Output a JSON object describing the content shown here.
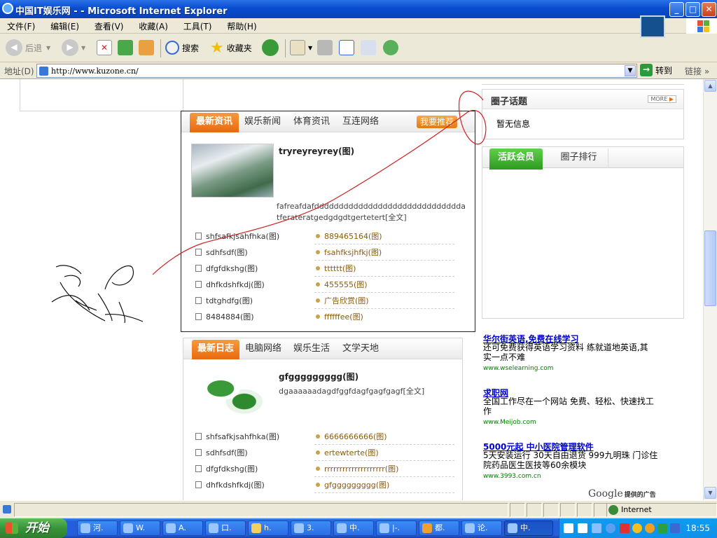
{
  "window": {
    "title": "中国IT娱乐网 - - Microsoft Internet Explorer",
    "min": "_",
    "max": "□",
    "close": "✕"
  },
  "menu": [
    "文件(F)",
    "编辑(E)",
    "查看(V)",
    "收藏(A)",
    "工具(T)",
    "帮助(H)"
  ],
  "toolbar": {
    "back": "后退",
    "search": "搜索",
    "favorites": "收藏夹"
  },
  "address": {
    "label": "地址(D)",
    "url": "http://www.kuzone.cn/",
    "go": "转到",
    "links": "链接"
  },
  "news": {
    "tabs": [
      "最新资讯",
      "娱乐新闻",
      "体育资讯",
      "互连网络"
    ],
    "recommend": "我要推荐",
    "headline": "tryreyreyrey(图)",
    "summary": "fafreafdafddddddddddddddddddddddddddddddatferateratgedgdgdtgertetert[全文]",
    "left": [
      "shfsafkjsahfhka(图)",
      "sdhfsdf(图)",
      "dfgfdkshg(图)",
      "dhfkdshfkdj(图)",
      "tdtghdfg(图)",
      "8484884(图)"
    ],
    "right": [
      "889465164(图)",
      "fsahfksjhfkj(图)",
      "tttttt(图)",
      "455555(图)",
      "广告欣赏(图)",
      "ffffffee(图)"
    ]
  },
  "blog": {
    "tabs": [
      "最新日志",
      "电脑网络",
      "娱乐生活",
      "文学天地"
    ],
    "headline": "gfggggggggg(图)",
    "summary": "dgaaaaaadagdfggfdagfgagfgagf[全文]",
    "left": [
      "shfsafkjsahfhka(图)",
      "sdhfsdf(图)",
      "dfgfdkshg(图)",
      "dhfkdshfkdj(图)"
    ],
    "right": [
      "6666666666(图)",
      "ertewterte(图)",
      "rrrrrrrrrrrrrrrrrrrr(图)",
      "gfggggggggg(图)"
    ]
  },
  "topics": {
    "title": "圈子话题",
    "more": "MORE",
    "empty": "暂无信息"
  },
  "members": {
    "tabs": [
      "活跃会员",
      "圈子排行"
    ]
  },
  "ads": [
    {
      "title": "华尔街英语,免费在线学习",
      "desc": "还可免费获得英语学习资料 练就道地英语,其实一点不难",
      "url": "www.wselearning.com"
    },
    {
      "title": "求职网",
      "desc": "全国工作尽在一个网站 免费、轻松、快速找工作",
      "url": "www.Meijob.com"
    },
    {
      "title": "5000元起 中小医院管理软件",
      "desc": "5天安装运行 30天自由退货 999九明珠 门诊住院药品医生医技等60余模块",
      "url": "www.3993.com.cn"
    }
  ],
  "google_ads": {
    "brand": "Google",
    "suffix": "提供的广告"
  },
  "status": {
    "zone": "Internet"
  },
  "taskbar": {
    "start": "开始",
    "tasks": [
      "河.",
      "W.",
      "A.",
      "口.",
      "h.",
      "3.",
      "中.",
      "|-.",
      "都.",
      "论.",
      "中."
    ],
    "clock": "18:55"
  },
  "colors": {
    "accent_orange": "#e8690e",
    "accent_green": "#3aa52a",
    "xp_blue": "#245edb"
  }
}
